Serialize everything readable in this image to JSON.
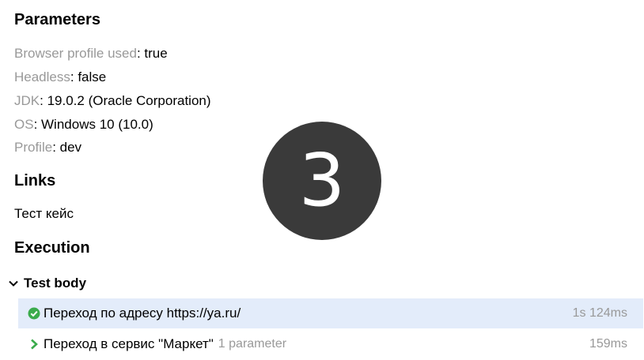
{
  "parameters": {
    "title": "Parameters",
    "items": [
      {
        "name": "Browser profile used",
        "value": "true"
      },
      {
        "name": "Headless",
        "value": "false"
      },
      {
        "name": "JDK",
        "value": "19.0.2 (Oracle Corporation)"
      },
      {
        "name": "OS",
        "value": "Windows 10 (10.0)"
      },
      {
        "name": "Profile",
        "value": "dev"
      }
    ],
    "separator": ": "
  },
  "links": {
    "title": "Links",
    "items": [
      {
        "label": "Тест кейс"
      }
    ]
  },
  "execution": {
    "title": "Execution",
    "test_body": {
      "label": "Test body",
      "steps": [
        {
          "title": "Переход по адресу https://ya.ru/",
          "params": "",
          "duration": "1s 124ms",
          "status": "passed"
        },
        {
          "title": "Переход в сервис \"Маркет\"",
          "params": "1 parameter",
          "duration": "159ms",
          "status": "collapsed"
        }
      ]
    }
  },
  "overlay": {
    "number": "3"
  },
  "colors": {
    "passed": "#3bab4c",
    "chevron": "#3bab4c",
    "muted": "#999999",
    "active_row": "#e3ecfa",
    "badge": "#3a3a3a"
  }
}
